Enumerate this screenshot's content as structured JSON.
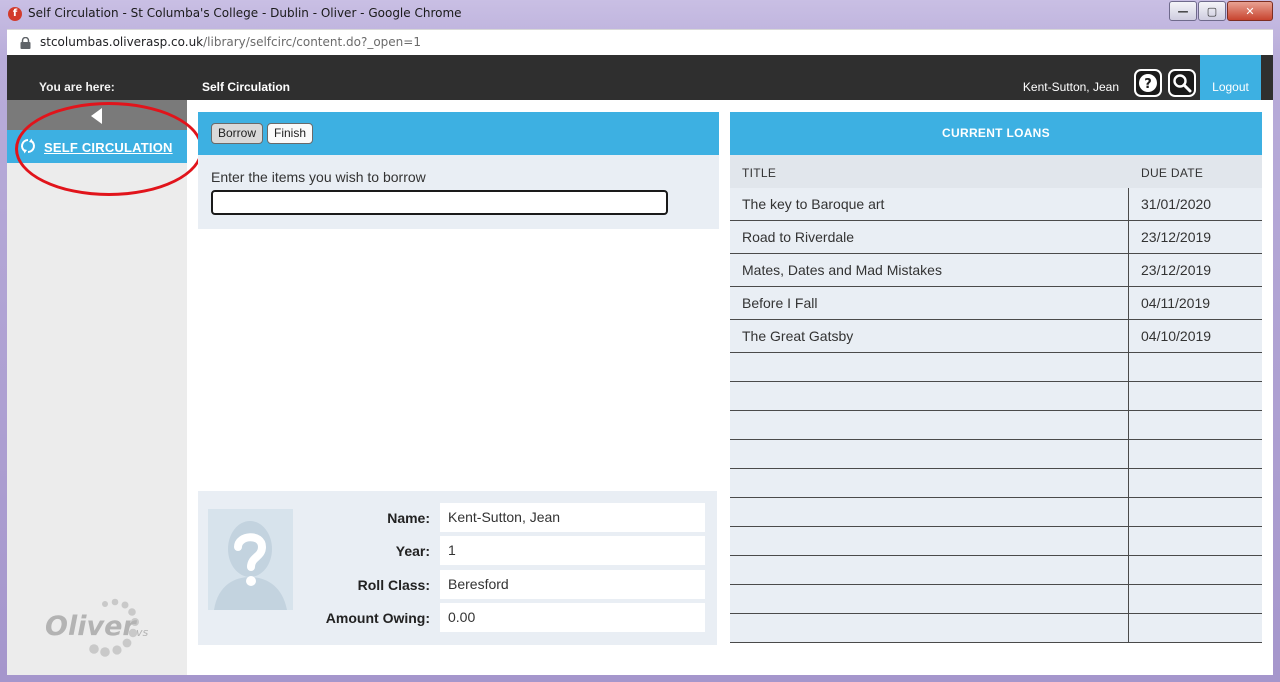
{
  "window": {
    "title": "Self Circulation - St Columba's College - Dublin - Oliver - Google Chrome",
    "favicon_letter": "f",
    "controls": [
      "—",
      "▢",
      "✕"
    ]
  },
  "address": {
    "host": "stcolumbas.oliverasp.co.uk",
    "path": "/library/selfcirc/content.do?_open=1"
  },
  "header": {
    "you_are_here": "You are here:",
    "breadcrumb": "Self Circulation",
    "user": "Kent-Sutton, Jean",
    "logout": "Logout",
    "help_glyph": "?"
  },
  "sidebar": {
    "item_label": "SELF CIRCULATION",
    "logo_text": "Oliver",
    "logo_suffix": "vs"
  },
  "borrow": {
    "tab_borrow": "Borrow",
    "tab_finish": "Finish",
    "prompt": "Enter the items you wish to borrow",
    "input_value": ""
  },
  "patron": {
    "name_label": "Name:",
    "name": "Kent-Sutton, Jean",
    "year_label": "Year:",
    "year": "1",
    "roll_label": "Roll Class:",
    "roll_class": "Beresford",
    "owing_label": "Amount Owing:",
    "owing": "0.00"
  },
  "loans": {
    "heading": "CURRENT LOANS",
    "col_title": "TITLE",
    "col_due": "DUE DATE",
    "rows": [
      {
        "title": "The key to Baroque art",
        "due": "31/01/2020"
      },
      {
        "title": "Road to Riverdale",
        "due": "23/12/2019"
      },
      {
        "title": "Mates, Dates and Mad Mistakes",
        "due": "23/12/2019"
      },
      {
        "title": "Before I Fall",
        "due": "04/11/2019"
      },
      {
        "title": "The Great Gatsby",
        "due": "04/10/2019"
      }
    ]
  },
  "colors": {
    "accent": "#3db0e2",
    "topbar": "#2f2f2f",
    "panel": "#e9eef4",
    "annotation": "#e1141b"
  }
}
